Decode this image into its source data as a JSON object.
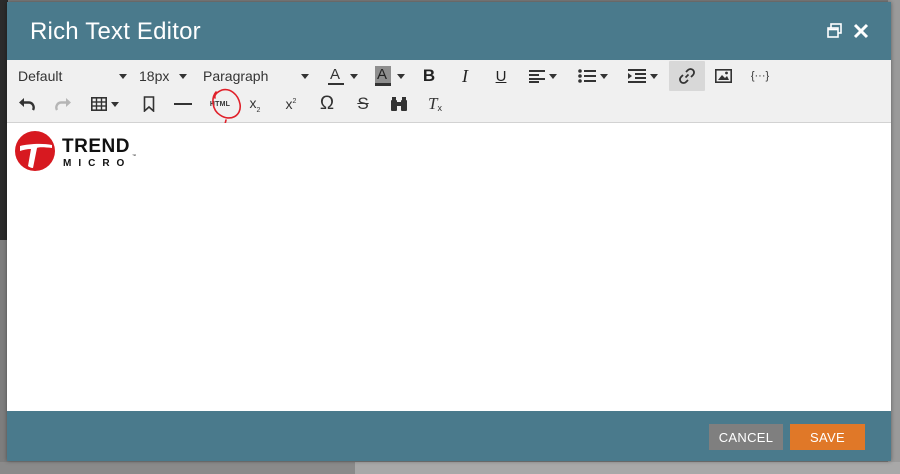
{
  "dialog": {
    "title": "Rich Text Editor"
  },
  "toolbar": {
    "font_family": "Default",
    "font_size": "18px",
    "block_format": "Paragraph",
    "text_color_glyph": "A",
    "bg_color_glyph": "A",
    "bold_glyph": "B",
    "italic_glyph": "I",
    "underline_glyph": "U",
    "source_code_glyph": "{···}",
    "html_glyph": "HTML",
    "subscript_glyph": "x",
    "subscript_mark": "2",
    "superscript_glyph": "x",
    "superscript_mark": "2",
    "special_char_glyph": "Ω",
    "strike_glyph": "S",
    "clear_format_glyph": "T",
    "clear_format_mark": "x"
  },
  "content": {
    "logo_line1": "TREND",
    "logo_line2": "MICRO",
    "logo_tm": "™"
  },
  "footer": {
    "cancel_label": "CANCEL",
    "save_label": "SAVE"
  },
  "colors": {
    "titlebar": "#4a7a8c",
    "save_button": "#e07828",
    "cancel_button": "#7f7f7f",
    "logo_red": "#d71920",
    "annotation_red": "#e0202a"
  }
}
